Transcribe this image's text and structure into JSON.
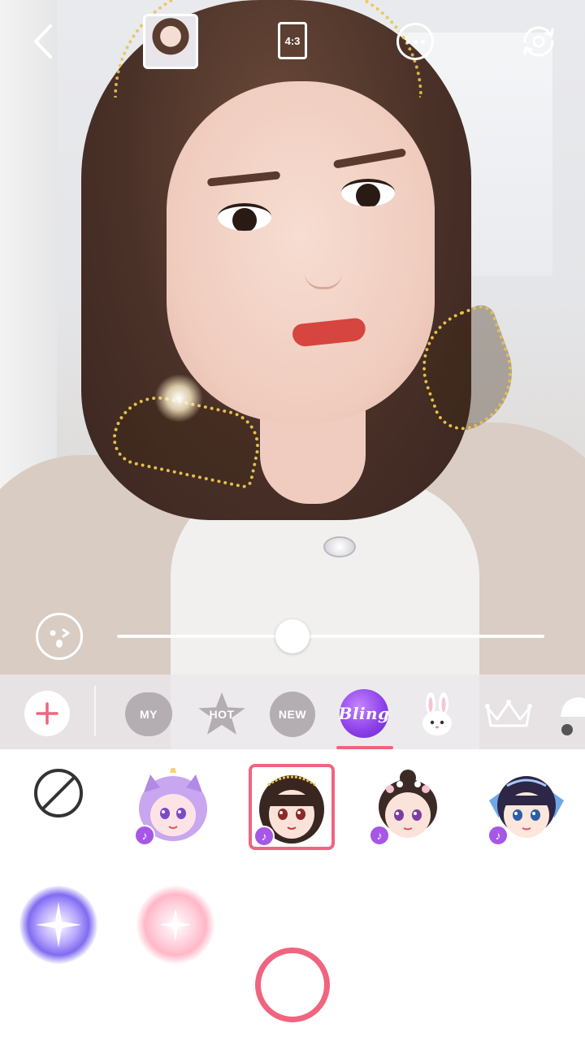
{
  "topbar": {
    "ratio_label": "4:3"
  },
  "icons": {
    "back": "chevron-left-icon",
    "thumbnail": "avatar",
    "more": "ellipsis-icon",
    "flip": "camera-flip-icon",
    "face_adjust": "face-wink-icon",
    "add": "plus-icon",
    "none": "no-filter-icon",
    "music": "music-note-icon"
  },
  "slider": {
    "value_fraction": 0.41
  },
  "categories": {
    "my": "MY",
    "hot": "HOT",
    "new": "NEW",
    "bling": "Bling",
    "bunny": "bunny-icon",
    "crown": "crown-icon",
    "hat": "hat-icon"
  },
  "colors": {
    "accent": "#f0647f",
    "music_badge": "#a657e6",
    "category_inactive": "#b4adb2",
    "bling": "#8a3ee8"
  },
  "stickers": [
    {
      "name": "unicorn-girl",
      "has_music": true,
      "selected": false
    },
    {
      "name": "golden-halo-wings",
      "has_music": true,
      "selected": true
    },
    {
      "name": "flower-bun-girl",
      "has_music": true,
      "selected": false
    },
    {
      "name": "fairy-wing-girl",
      "has_music": true,
      "selected": false
    }
  ]
}
